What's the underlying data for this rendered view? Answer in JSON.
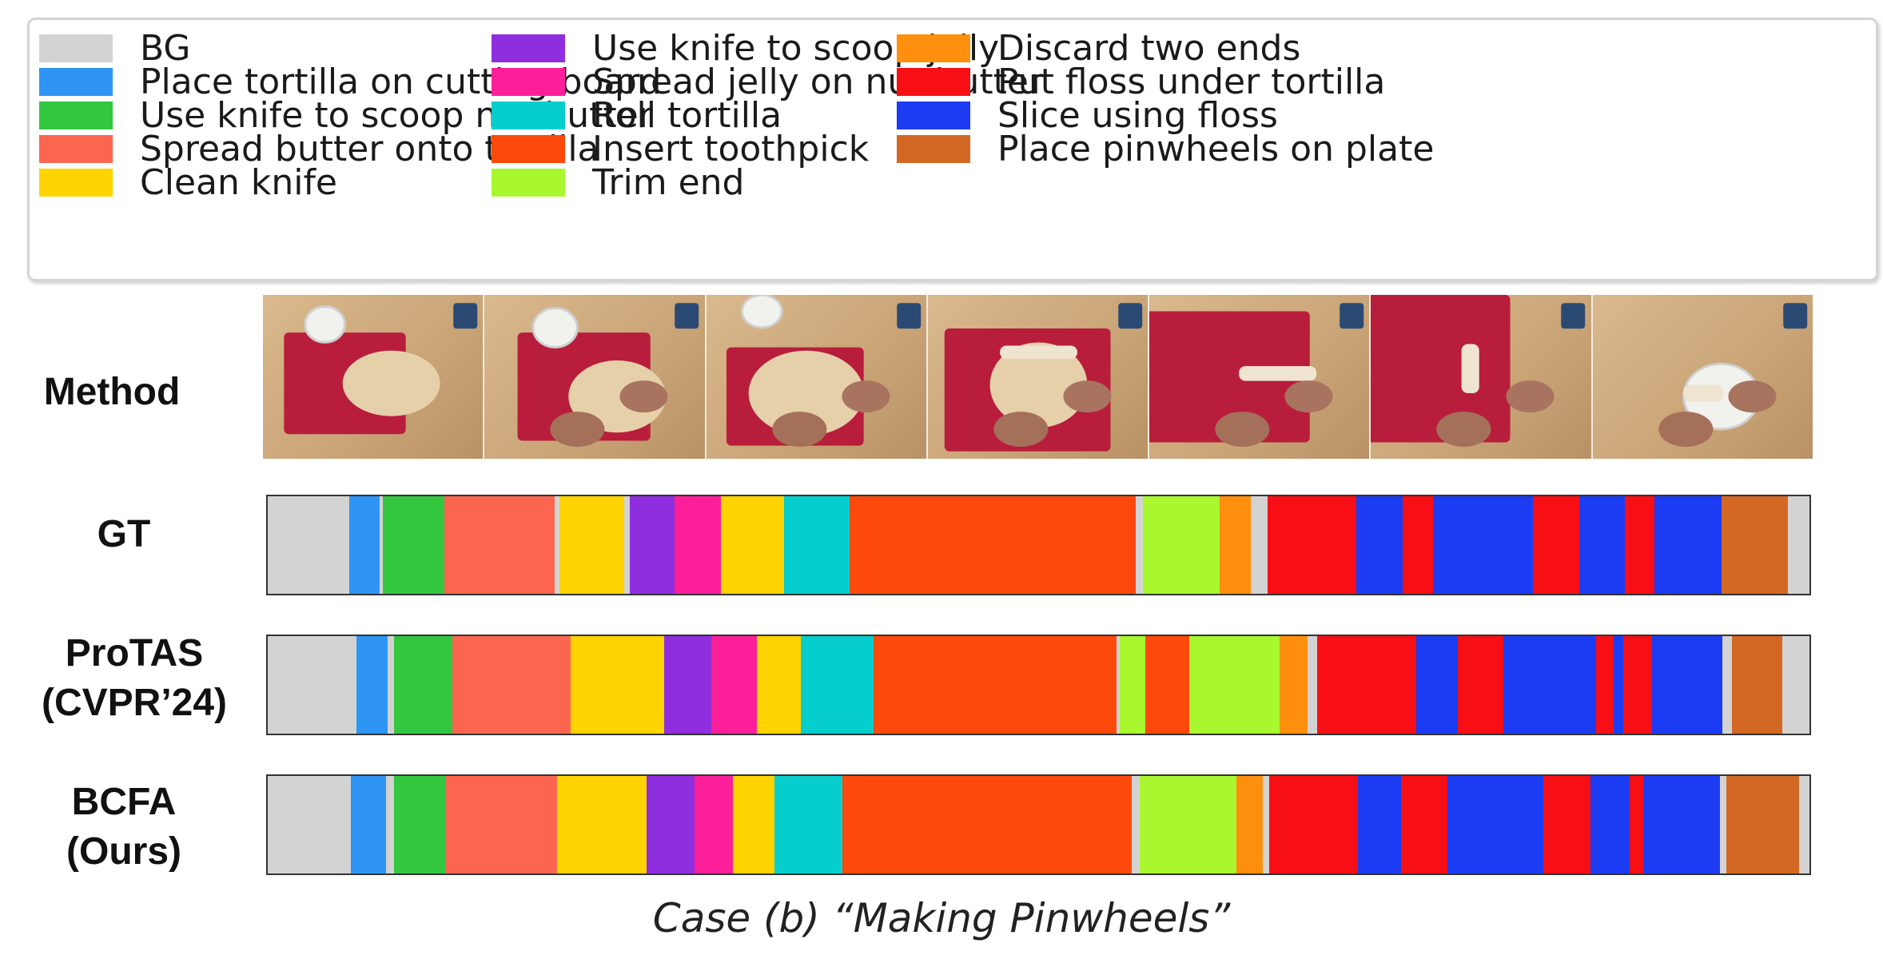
{
  "legend": [
    {
      "label": "BG",
      "color": "#d3d3d3"
    },
    {
      "label": "Place tortilla on cutting board",
      "color": "#2f95f4"
    },
    {
      "label": "Use knife to scoop nut butter",
      "color": "#33c63f"
    },
    {
      "label": "Spread butter onto tortilla",
      "color": "#fc6650"
    },
    {
      "label": "Clean knife",
      "color": "#ffd400"
    },
    {
      "label": "Use knife to scoop jelly",
      "color": "#8e2ede"
    },
    {
      "label": "Spread jelly on nut butter",
      "color": "#fd1f9a"
    },
    {
      "label": "Roll tortilla",
      "color": "#05cecd"
    },
    {
      "label": "Insert toothpick",
      "color": "#fd4a0c"
    },
    {
      "label": "Trim end",
      "color": "#a8f72f"
    },
    {
      "label": "Discard two ends",
      "color": "#ff8f0c"
    },
    {
      "label": "Put floss under tortilla",
      "color": "#f80f15"
    },
    {
      "label": "Slice using floss",
      "color": "#1b3cf3"
    },
    {
      "label": "Place pinwheels on plate",
      "color": "#d36825"
    }
  ],
  "rows": [
    {
      "label": "Method"
    },
    {
      "label": "GT"
    },
    {
      "label": "ProTAS\n(CVPR’24)"
    },
    {
      "label": "BCFA\n(Ours)"
    }
  ],
  "frame_count": 7,
  "segmentations": [
    {
      "name": "GT",
      "segments": [
        [
          0,
          0.053
        ],
        [
          1,
          0.02
        ],
        [
          0,
          0.002
        ],
        [
          2,
          0.04
        ],
        [
          3,
          0.072
        ],
        [
          0,
          0.003
        ],
        [
          4,
          0.042
        ],
        [
          0,
          0.004
        ],
        [
          5,
          0.029
        ],
        [
          6,
          0.03
        ],
        [
          4,
          0.041
        ],
        [
          7,
          0.043
        ],
        [
          8,
          0.186
        ],
        [
          0,
          0.005
        ],
        [
          9,
          0.05
        ],
        [
          10,
          0.02
        ],
        [
          0,
          0.011
        ],
        [
          11,
          0.058
        ],
        [
          12,
          0.03
        ],
        [
          11,
          0.02
        ],
        [
          12,
          0.065
        ],
        [
          11,
          0.03
        ],
        [
          12,
          0.03
        ],
        [
          11,
          0.019
        ],
        [
          12,
          0.044
        ],
        [
          13,
          0.043
        ],
        [
          0,
          0.014
        ]
      ]
    },
    {
      "name": "ProTAS",
      "segments": [
        [
          0,
          0.055
        ],
        [
          1,
          0.019
        ],
        [
          0,
          0.004
        ],
        [
          2,
          0.036
        ],
        [
          3,
          0.073
        ],
        [
          4,
          0.058
        ],
        [
          5,
          0.029
        ],
        [
          6,
          0.028
        ],
        [
          4,
          0.027
        ],
        [
          7,
          0.045
        ],
        [
          8,
          0.15
        ],
        [
          0,
          0.002
        ],
        [
          9,
          0.016
        ],
        [
          8,
          0.027
        ],
        [
          9,
          0.056
        ],
        [
          10,
          0.017
        ],
        [
          0,
          0.006
        ],
        [
          11,
          0.061
        ],
        [
          12,
          0.026
        ],
        [
          11,
          0.028
        ],
        [
          12,
          0.057
        ],
        [
          11,
          0.011
        ],
        [
          12,
          0.006
        ],
        [
          11,
          0.018
        ],
        [
          12,
          0.043
        ],
        [
          0,
          0.006
        ],
        [
          13,
          0.031
        ],
        [
          0,
          0.017
        ]
      ]
    },
    {
      "name": "BCFA",
      "segments": [
        [
          0,
          0.054
        ],
        [
          1,
          0.023
        ],
        [
          0,
          0.005
        ],
        [
          2,
          0.033
        ],
        [
          3,
          0.073
        ],
        [
          4,
          0.058
        ],
        [
          5,
          0.031
        ],
        [
          6,
          0.025
        ],
        [
          4,
          0.027
        ],
        [
          7,
          0.044
        ],
        [
          8,
          0.188
        ],
        [
          0,
          0.005
        ],
        [
          9,
          0.063
        ],
        [
          10,
          0.017
        ],
        [
          0,
          0.004
        ],
        [
          11,
          0.058
        ],
        [
          12,
          0.028
        ],
        [
          11,
          0.03
        ],
        [
          12,
          0.062
        ],
        [
          11,
          0.031
        ],
        [
          12,
          0.025
        ],
        [
          11,
          0.009
        ],
        [
          12,
          0.05
        ],
        [
          0,
          0.004
        ],
        [
          13,
          0.047
        ],
        [
          0,
          0.007
        ]
      ]
    }
  ],
  "caption": "Case (b) “Making Pinwheels”"
}
